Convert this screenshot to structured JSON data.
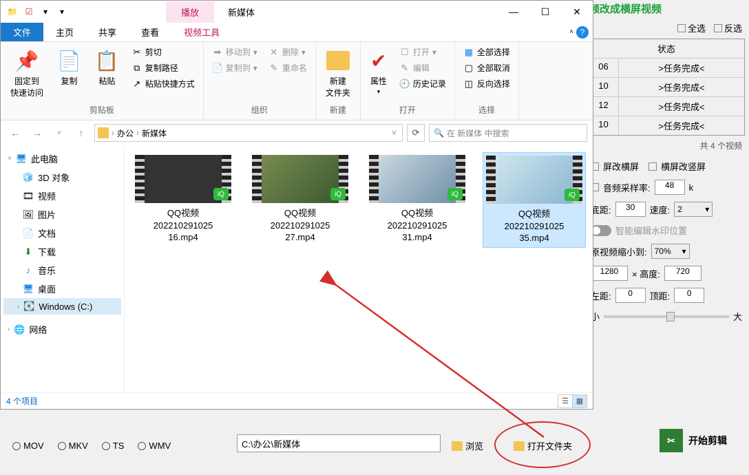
{
  "titlebar": {
    "play_tab": "播放",
    "title": "新媒体"
  },
  "ribbon_tabs": {
    "file": "文件",
    "home": "主页",
    "share": "共享",
    "view": "查看",
    "video_tools": "视频工具"
  },
  "ribbon": {
    "pin": "固定到\n快速访问",
    "copy": "复制",
    "paste": "粘贴",
    "cut": "剪切",
    "copy_path": "复制路径",
    "paste_shortcut": "粘贴快捷方式",
    "group_clipboard": "剪贴板",
    "move_to": "移动到",
    "copy_to": "复制到",
    "delete": "删除",
    "rename": "重命名",
    "group_organize": "组织",
    "new_folder": "新建\n文件夹",
    "group_new": "新建",
    "properties": "属性",
    "open": "打开",
    "edit": "编辑",
    "history": "历史记录",
    "group_open": "打开",
    "select_all": "全部选择",
    "select_none": "全部取消",
    "invert_sel": "反向选择",
    "group_select": "选择"
  },
  "breadcrumb": {
    "seg1": "办公",
    "seg2": "新媒体"
  },
  "search_placeholder": "在 新媒体 中搜索",
  "tree": {
    "this_pc": "此电脑",
    "objects_3d": "3D 对象",
    "videos": "视频",
    "pictures": "图片",
    "documents": "文档",
    "downloads": "下载",
    "music": "音乐",
    "desktop": "桌面",
    "windows_c": "Windows  (C:)",
    "network": "网络"
  },
  "files": [
    {
      "line1": "QQ视频",
      "line2": "202210291025",
      "line3": "16.mp4",
      "bg": "linear-gradient(135deg,#e8b090,#c57050)"
    },
    {
      "line1": "QQ视频",
      "line2": "202210291025",
      "line3": "27.mp4",
      "bg": "linear-gradient(135deg,#7a8a50,#3a5a30)"
    },
    {
      "line1": "QQ视频",
      "line2": "202210291025",
      "line3": "31.mp4",
      "bg": "linear-gradient(135deg,#c9d8e0,#7090a8)"
    },
    {
      "line1": "QQ视频",
      "line2": "202210291025",
      "line3": "35.mp4",
      "bg": "linear-gradient(135deg,#cfe6f0,#8ab6d0)"
    }
  ],
  "status": "4 个项目",
  "bgapp": {
    "title": "频改成横屏视频",
    "select_all": "全选",
    "invert": "反选",
    "col_status": "状态",
    "rows": [
      {
        "id": "06",
        "status": ">任务完成<"
      },
      {
        "id": "10",
        "status": ">任务完成<"
      },
      {
        "id": "12",
        "status": ">任务完成<"
      },
      {
        "id": "10",
        "status": ">任务完成<"
      }
    ],
    "count": "共 4 个视频",
    "vert_to_horiz": "屏改横屏",
    "horiz_to_vert": "横屏改竖屏",
    "audio_rate": "音频采样率:",
    "audio_val": "48",
    "audio_unit": "k",
    "bottom_margin": "底距:",
    "bottom_val": "30",
    "speed": "速度:",
    "speed_val": "2",
    "smart_watermark": "智能编辑水印位置",
    "shrink_to": "原视频缩小到:",
    "shrink_val": "70%",
    "width_val": "1280",
    "height_lbl": "× 高度:",
    "height_val": "720",
    "left_margin": "左距:",
    "left_val": "0",
    "top_margin": "顶距:",
    "top_val": "0",
    "small": "小",
    "big": "大"
  },
  "bottom": {
    "mov": "MOV",
    "mkv": "MKV",
    "ts": "TS",
    "wmv": "WMV",
    "path": "C:\\办公\\新媒体",
    "browse": "浏览",
    "open_folder": "打开文件夹",
    "start": "开始剪辑"
  }
}
